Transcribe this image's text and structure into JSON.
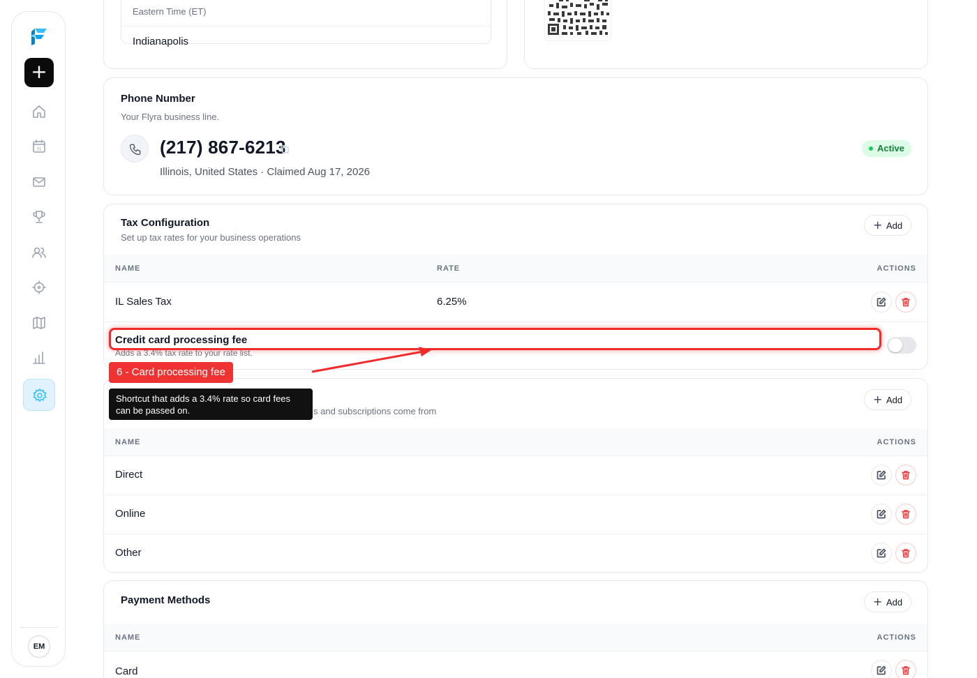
{
  "sidebar": {
    "new_label": "+",
    "avatar_initials": "EM",
    "icons": [
      "home-icon",
      "calendar-icon",
      "mail-icon",
      "trophy-icon",
      "users-icon",
      "target-icon",
      "map-icon",
      "bar-chart-icon",
      "settings-icon"
    ],
    "calendar_day": "31"
  },
  "timezone": {
    "group": "Eastern Time (ET)",
    "item": "Indianapolis"
  },
  "phone": {
    "title": "Phone Number",
    "subtitle": "Your Flyra business line.",
    "number": "(217) 867-6213",
    "meta": "Illinois, United States · Claimed Aug 17, 2026",
    "status": "Active"
  },
  "tax": {
    "title": "Tax Configuration",
    "subtitle": "Set up tax rates for your business operations",
    "add_label": "Add",
    "headers": {
      "name": "NAME",
      "rate": "RATE",
      "actions": "ACTIONS"
    },
    "rows": [
      {
        "name": "IL Sales Tax",
        "rate": "6.25%"
      }
    ],
    "fee": {
      "title": "Credit card processing fee",
      "desc": "Adds a 3.4% tax rate to your rate list.",
      "enabled": false
    }
  },
  "sources": {
    "subtitle_visible": "s and subscriptions come from",
    "add_label": "Add",
    "headers": {
      "name": "NAME",
      "actions": "ACTIONS"
    },
    "rows": [
      {
        "name": "Direct"
      },
      {
        "name": "Online"
      },
      {
        "name": "Other"
      }
    ]
  },
  "payments": {
    "title": "Payment Methods",
    "add_label": "Add",
    "headers": {
      "name": "NAME",
      "actions": "ACTIONS"
    },
    "rows": [
      {
        "name": "Card"
      }
    ]
  },
  "annotation": {
    "label": "6 - Card processing fee",
    "tooltip": "Shortcut that adds a 3.4% rate so card fees can be passed on.",
    "color": "#ef3333"
  },
  "colors": {
    "accent": "#38bdf8",
    "active_badge_bg": "#dcfce7",
    "active_badge_text": "#15803d",
    "delete": "#ef4444"
  }
}
